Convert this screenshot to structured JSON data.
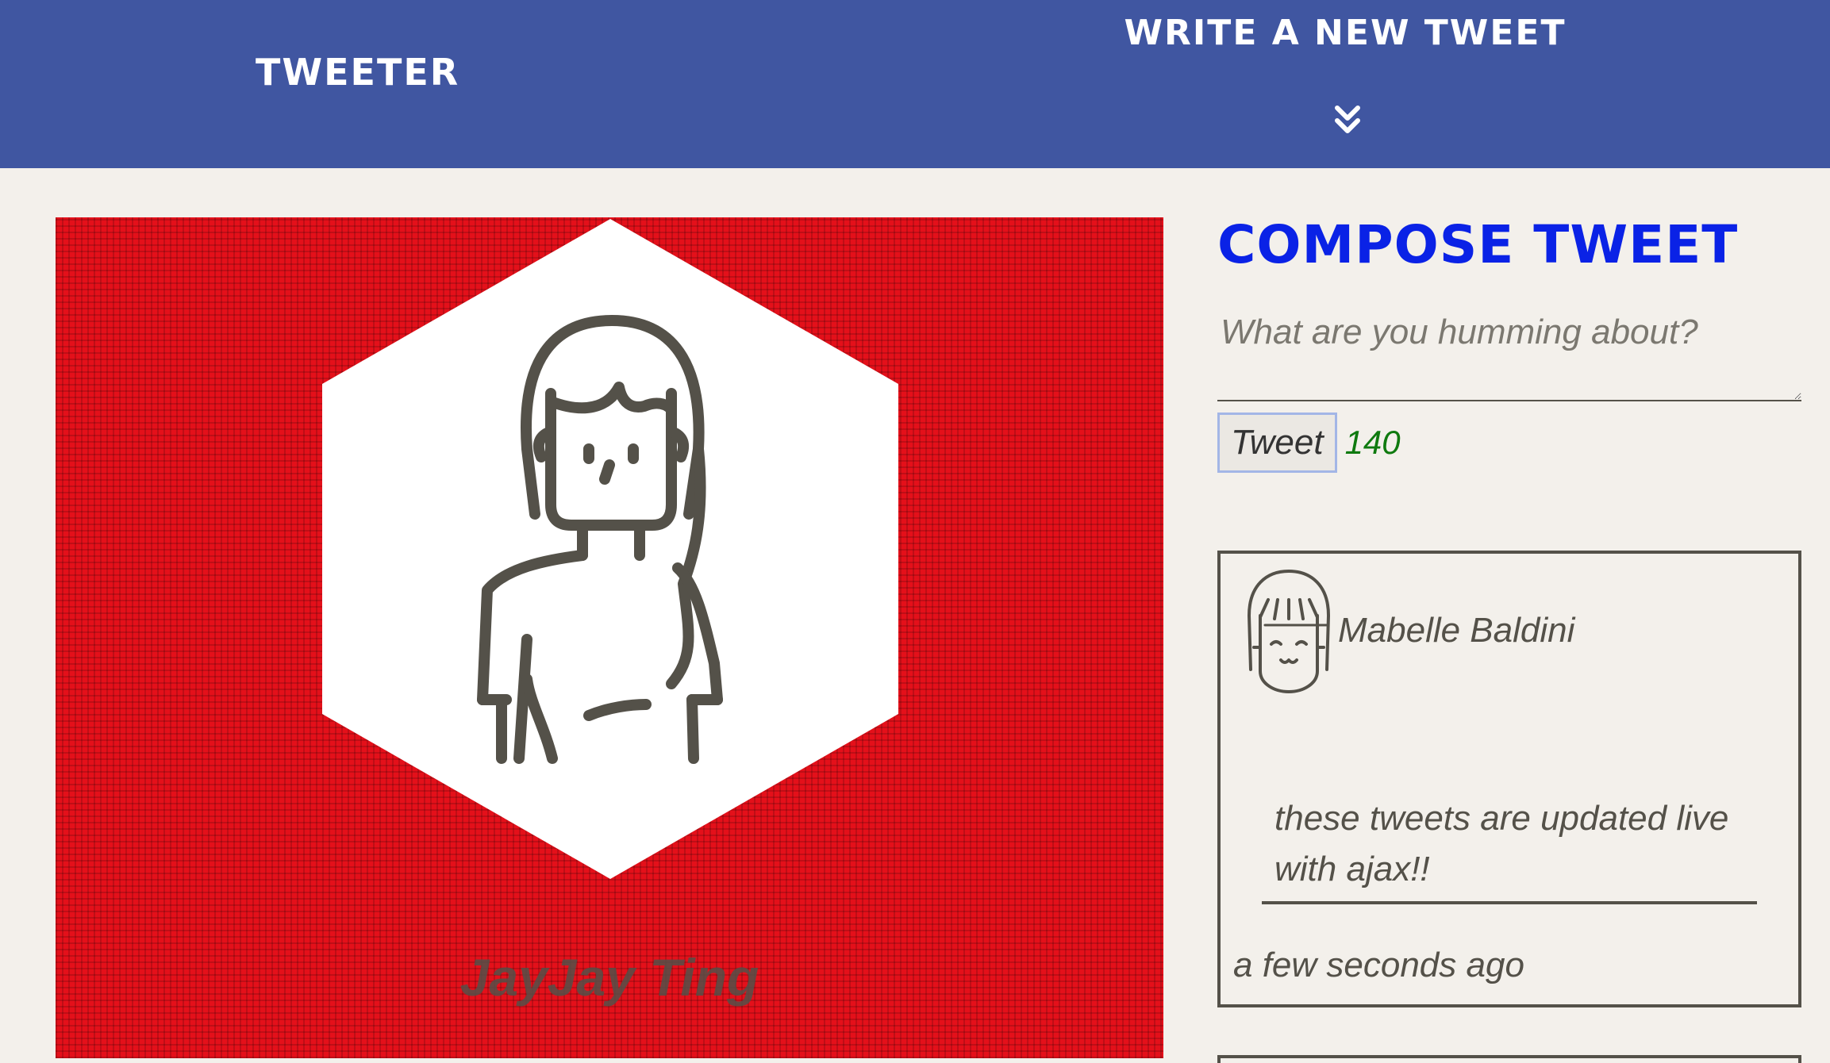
{
  "nav": {
    "brand": "Tweeter",
    "compose_label": "Write a new tweet",
    "compose_icon": "double-chevron-down-icon"
  },
  "profile": {
    "name": "JayJay Ting",
    "avatar_icon": "user-avatar-icon",
    "background_color": "#e4101a"
  },
  "compose": {
    "title": "Compose Tweet",
    "placeholder": "What are you humming about?",
    "button_label": "Tweet",
    "char_count": "140"
  },
  "tweets": [
    {
      "user": "Mabelle Baldini",
      "avatar_icon": "user-avatar-icon",
      "text": "these tweets are updated live with ajax!!",
      "time": "a few seconds ago"
    }
  ],
  "colors": {
    "nav_bg": "#4056a1",
    "page_bg": "#f3f0eb",
    "title_blue": "#0a22e6",
    "counter_green": "#0f7a0f",
    "text": "#545149"
  }
}
